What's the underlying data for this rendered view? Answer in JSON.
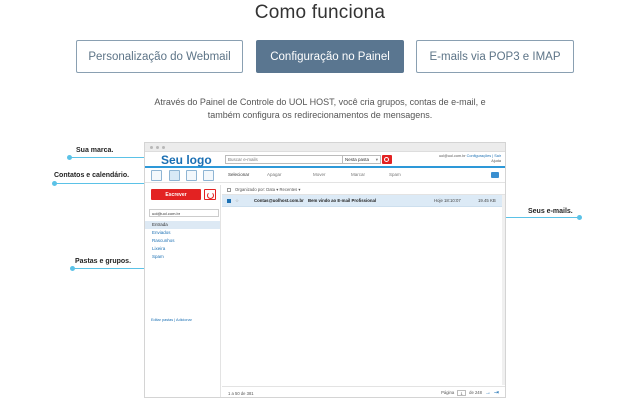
{
  "header": {
    "title": "Como funciona"
  },
  "tabs": [
    {
      "label": "Personalização do Webmail",
      "active": false
    },
    {
      "label": "Configuração no Painel",
      "active": true
    },
    {
      "label": "E-mails via POP3 e IMAP",
      "active": false
    }
  ],
  "description": "Através do Painel de Controle do UOL HOST, você cria grupos, contas de e-mail, e também configura os redirecionamentos de mensagens.",
  "callouts": {
    "brand": "Sua marca.",
    "contacts": "Contatos e calendário.",
    "folders": "Pastas e grupos.",
    "emails": "Seus e-mails."
  },
  "colors": {
    "accent": "#5bc2e7",
    "active_tab": "#5a7690",
    "brand_blue": "#1a6fb3",
    "compose_red": "#e32222",
    "selected_row": "#dceaf6"
  },
  "webmail": {
    "logo": "Seu logo",
    "search_placeholder": "Buscar e-mails",
    "folder_select": "Nesta pasta",
    "user_email": "uol@uol.com.br",
    "user_links": "Configurações | Sair",
    "user_meta": "Ajuda",
    "toolbar": {
      "select": "Selecionar",
      "delete": "Apagar",
      "move": "Mover",
      "mark": "Marcar",
      "spam": "Spam"
    },
    "compose_label": "Escrever",
    "account_select": "uol@uol.com.br",
    "folders": [
      "Entrada",
      "Enviados",
      "Rascunhos",
      "Lixeira",
      "Spam"
    ],
    "edit_folders": "Editar pastas | Adicionar",
    "sort": {
      "label": "Organizado por:",
      "by": "Data",
      "order": "Recentes"
    },
    "messages": [
      {
        "from": "Contas@uolhost.com.br",
        "subject": "Bem vindo ao E-mail Profissional",
        "date": "Hoje 18:10:07",
        "size": "19.45 KB"
      }
    ],
    "footer": {
      "count": "1 a 50 de 381",
      "page_label": "Página",
      "page": "1",
      "page_total": "de 248"
    },
    "icons": [
      "contacts-icon",
      "email-view-icon",
      "user-icon",
      "calendar-icon",
      "refresh-icon",
      "search-icon"
    ]
  }
}
